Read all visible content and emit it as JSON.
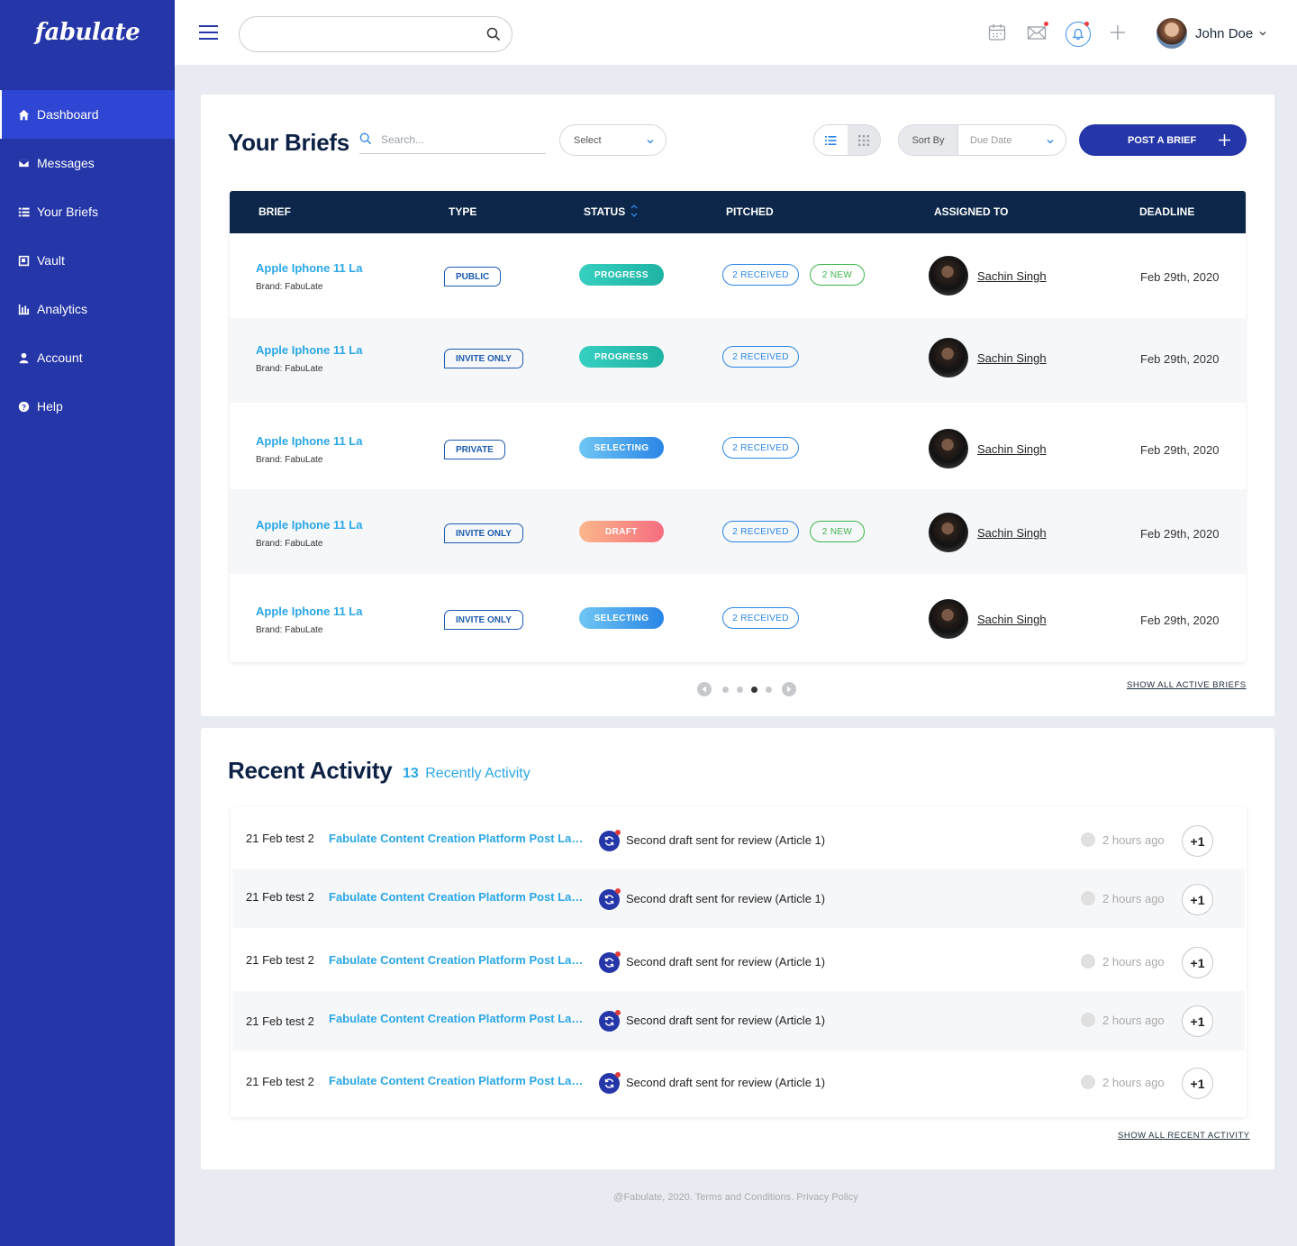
{
  "brand": {
    "logo_text": "fabulate"
  },
  "sidebar": {
    "items": [
      {
        "label": "Dashboard",
        "icon": "home-icon",
        "active": true
      },
      {
        "label": "Messages",
        "icon": "envelope-icon"
      },
      {
        "label": "Your Briefs",
        "icon": "list-icon"
      },
      {
        "label": "Vault",
        "icon": "vault-icon"
      },
      {
        "label": "Analytics",
        "icon": "bar-chart-icon"
      },
      {
        "label": "Account",
        "icon": "user-icon"
      },
      {
        "label": "Help",
        "icon": "help-icon"
      }
    ]
  },
  "header": {
    "search_placeholder": "",
    "icons": [
      "menu-icon",
      "search-icon",
      "calendar-icon",
      "mail-icon",
      "bell-icon",
      "plus-icon"
    ],
    "user_name": "John Doe"
  },
  "briefs": {
    "title": "Your Briefs",
    "search_placeholder": "Search...",
    "select_label": "Select",
    "sort_label": "Sort By",
    "sort_value": "Due Date",
    "post_button": "POST A BRIEF",
    "columns": [
      "BRIEF",
      "TYPE",
      "STATUS",
      "PITCHED",
      "ASSIGNED TO",
      "DEADLINE"
    ],
    "rows": [
      {
        "name": "Apple Iphone 11 La",
        "brand": "Brand: FabuLate",
        "type": "PUBLIC",
        "status": "PROGRESS",
        "received": "2 RECEIVED",
        "new": "2 NEW",
        "assignee": "Sachin Singh",
        "deadline": "Feb 29th, 2020"
      },
      {
        "name": "Apple Iphone 11 La",
        "brand": "Brand: FabuLate",
        "type": "INVITE ONLY",
        "status": "PROGRESS",
        "received": "2 RECEIVED",
        "new": "",
        "assignee": "Sachin Singh",
        "deadline": "Feb 29th, 2020"
      },
      {
        "name": "Apple Iphone 11 La",
        "brand": "Brand: FabuLate",
        "type": "PRIVATE",
        "status": "SELECTING",
        "received": "2 RECEIVED",
        "new": "",
        "assignee": "Sachin Singh",
        "deadline": "Feb 29th, 2020"
      },
      {
        "name": "Apple Iphone 11 La",
        "brand": "Brand: FabuLate",
        "type": "INVITE ONLY",
        "status": "DRAFT",
        "received": "2 RECEIVED",
        "new": "2 NEW",
        "assignee": "Sachin Singh",
        "deadline": "Feb 29th, 2020"
      },
      {
        "name": "Apple Iphone 11 La",
        "brand": "Brand: FabuLate",
        "type": "INVITE ONLY",
        "status": "SELECTING",
        "received": "2 RECEIVED",
        "new": "",
        "assignee": "Sachin Singh",
        "deadline": "Feb 29th, 2020"
      }
    ],
    "pagination": {
      "pages": 4,
      "current": 3
    },
    "show_all": "SHOW ALL ACTIVE BRIEFS"
  },
  "activity": {
    "title": "Recent Activity",
    "count": "13",
    "count_label": "Recently Activity",
    "rows": [
      {
        "project": "21 Feb test 2",
        "title": "Fabulate Content Creation Platform Post Launch",
        "message": "Second draft sent for review (Article 1)",
        "time": "2 hours ago",
        "badge": "+1"
      },
      {
        "project": "21 Feb test 2",
        "title": "Fabulate Content Creation Platform Post Launch",
        "message": "Second draft sent for review (Article 1)",
        "time": "2 hours ago",
        "badge": "+1"
      },
      {
        "project": "21 Feb test 2",
        "title": "Fabulate Content Creation Platform Post Launch",
        "message": "Second draft sent for review (Article 1)",
        "time": "2 hours ago",
        "badge": "+1"
      },
      {
        "project": "21 Feb test 2",
        "title": "Fabulate Content Creation Platform Post Launch",
        "message": "Second draft sent for review (Article 1)",
        "time": "2 hours ago",
        "badge": "+1"
      },
      {
        "project": "21 Feb test 2",
        "title": "Fabulate Content Creation Platform Post Launch",
        "message": "Second draft sent for review (Article 1)",
        "time": "2 hours ago",
        "badge": "+1"
      }
    ],
    "show_all": "SHOW ALL RECENT ACTIVITY"
  },
  "footer": {
    "text": "@Fabulate, 2020. Terms and Conditions.  Privacy Policy"
  },
  "colors": {
    "sidebar": "#2536a8",
    "active_nav": "#2f46d4",
    "table_header": "#0c2749",
    "link": "#2aa7e6",
    "progress": "#1fb3a3",
    "selecting": "#2a86e6",
    "draft": "#f66d7f",
    "new": "#3bb54a"
  }
}
